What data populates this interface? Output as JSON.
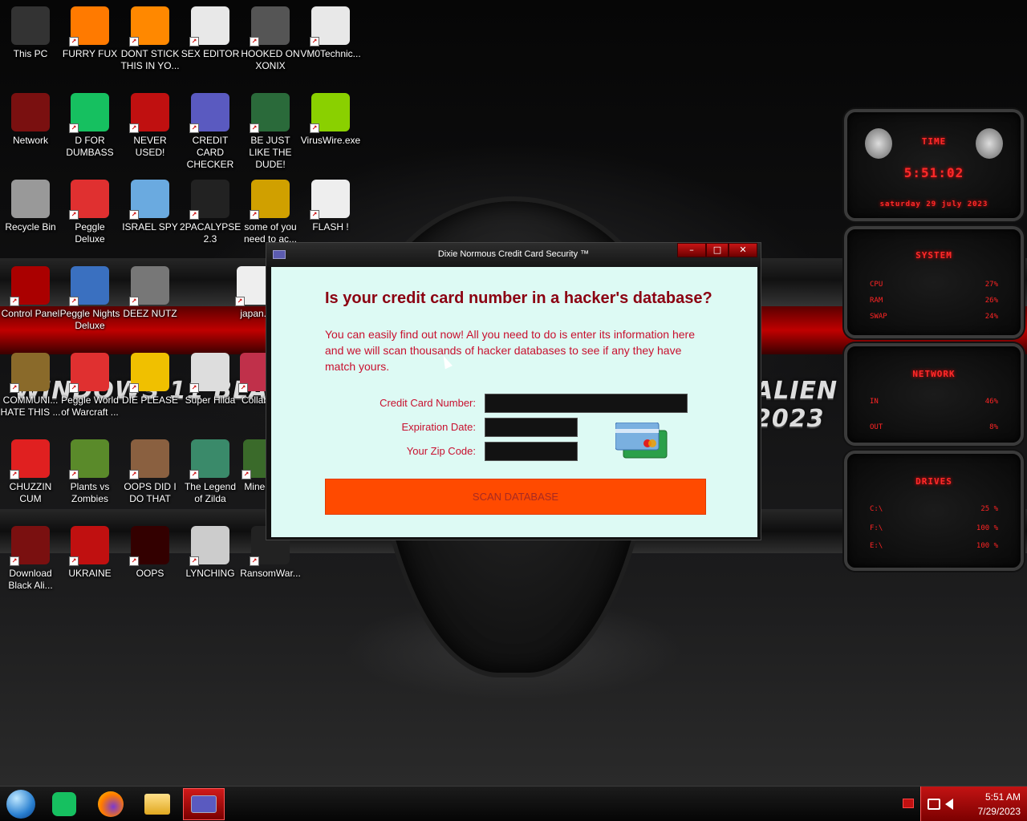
{
  "desktop": {
    "wallpaper_text_left": "WINDOWS 11 BLACK",
    "wallpaper_text_right": "ALIEN EDITION 2023",
    "icons": [
      {
        "label": "This PC",
        "icon": "computer-icon",
        "color": "#333"
      },
      {
        "label": "FURRY FUX",
        "icon": "firefox-icon",
        "color": "#ff7a00"
      },
      {
        "label": "DONT STICK THIS IN YO...",
        "icon": "vlc-cone-icon",
        "color": "#ff8800"
      },
      {
        "label": "SEX EDITOR",
        "icon": "hxd-icon",
        "color": "#e8e8e8"
      },
      {
        "label": "HOOKED ON XONIX",
        "icon": "xonix-icon",
        "color": "#555"
      },
      {
        "label": "VM0Technic...",
        "icon": "doctor-icon",
        "color": "#e8e8e8"
      },
      {
        "label": "Network",
        "icon": "alien-network-icon",
        "color": "#7a1010"
      },
      {
        "label": "D FOR DUMBASS",
        "icon": "chat-icon",
        "color": "#16c060"
      },
      {
        "label": "NEVER USED!",
        "icon": "devcpp-icon",
        "color": "#c01010"
      },
      {
        "label": "CREDIT CARD CHECKER",
        "icon": "credit-card-icon",
        "color": "#5a5ac0"
      },
      {
        "label": "BE JUST LIKE THE DUDE!",
        "icon": "santa-icon",
        "color": "#2a6a3a"
      },
      {
        "label": "VirusWire.exe",
        "icon": "lime-icon",
        "color": "#8ad000"
      },
      {
        "label": "Recycle Bin",
        "icon": "recycle-bin-icon",
        "color": "#999"
      },
      {
        "label": "Peggle Deluxe",
        "icon": "peggle-icon",
        "color": "#e03030"
      },
      {
        "label": "ISRAEL SPY",
        "icon": "network-spy-icon",
        "color": "#6aaae0"
      },
      {
        "label": "2PACALYPSE 2.3",
        "icon": "terminal-icon",
        "color": "#222"
      },
      {
        "label": "some of you need to ac...",
        "icon": "beaver-icon",
        "color": "#d0a000"
      },
      {
        "label": "FLASH !",
        "icon": "flash-icon",
        "color": "#eee"
      },
      {
        "label": "Control Panel",
        "icon": "control-panel-icon",
        "color": "#a00"
      },
      {
        "label": "Peggle Nights Deluxe",
        "icon": "peggle-nights-icon",
        "color": "#3a70c0"
      },
      {
        "label": "DEEZ NUTZ",
        "icon": "windows-stack-icon",
        "color": "#777"
      },
      {
        "label": "japan...",
        "icon": "japan-icon",
        "color": "#eee"
      },
      {
        "label": "COMMUNI... HATE THIS ...",
        "icon": "money-bag-icon",
        "color": "#8a6a2a"
      },
      {
        "label": "Peggle World of Warcraft ...",
        "icon": "peggle-wow-icon",
        "color": "#e03030"
      },
      {
        "label": "DIE PLEASE",
        "icon": "de-icon",
        "color": "#f0c000"
      },
      {
        "label": "Super Hilda",
        "icon": "pixel-dog-icon",
        "color": "#ddd"
      },
      {
        "label": "Collab...",
        "icon": "collab-icon",
        "color": "#c0304a"
      },
      {
        "label": "CHUZZIN CUM",
        "icon": "chuzzle-icon",
        "color": "#e02020"
      },
      {
        "label": "Plants vs Zombies",
        "icon": "flower-icon",
        "color": "#5a8a2a"
      },
      {
        "label": "OOPS DID I DO THAT",
        "icon": "portrait-icon",
        "color": "#8a6040"
      },
      {
        "label": "The Legend of Zilda",
        "icon": "pixel-hero-icon",
        "color": "#3a8a6a"
      },
      {
        "label": "Minecr...",
        "icon": "minecraft-icon",
        "color": "#3a6a2a"
      },
      {
        "label": "Download Black Ali...",
        "icon": "alien-download-icon",
        "color": "#7a1010"
      },
      {
        "label": "UKRAINE",
        "icon": "radiation-icon",
        "color": "#c01010"
      },
      {
        "label": "OOPS",
        "icon": "alienware-icon",
        "color": "#300"
      },
      {
        "label": "LYNCHING",
        "icon": "rope-icon",
        "color": "#ccc"
      },
      {
        "label": "RansomWar...",
        "icon": "skull-icon",
        "color": "#222"
      }
    ]
  },
  "gadgets": {
    "time": {
      "title": "TIME",
      "clock": "5:51:02",
      "date": "saturday 29 july 2023"
    },
    "system": {
      "title": "SYSTEM",
      "rows": [
        {
          "label": "CPU",
          "value": "27%"
        },
        {
          "label": "RAM",
          "value": "26%"
        },
        {
          "label": "SWAP",
          "value": "24%"
        }
      ]
    },
    "network": {
      "title": "NETWORK",
      "rows": [
        {
          "label": "IN",
          "value": "46%"
        },
        {
          "label": "OUT",
          "value": "8%"
        }
      ]
    },
    "drives": {
      "title": "DRIVES",
      "rows": [
        {
          "label": "C:\\",
          "value": "25 %"
        },
        {
          "label": "F:\\",
          "value": "100 %"
        },
        {
          "label": "E:\\",
          "value": "100 %"
        }
      ]
    }
  },
  "dialog": {
    "title": "Dixie Normous Credit Card Security ™",
    "minimize": "–",
    "maximize": "□",
    "close": "✕",
    "heading": "Is your credit card number in a hacker's database?",
    "description": "You can easily find out now! All you need to do is enter its information here and we will scan thousands of hacker databases to see if any they have match yours.",
    "fields": {
      "card_label": "Credit Card Number:",
      "card_value": "",
      "expiry_label": "Expiration Date:",
      "expiry_value": "",
      "zip_label": "Your Zip Code:",
      "zip_value": ""
    },
    "scan_button": "SCAN DATABASE"
  },
  "taskbar": {
    "items": [
      "start-orb-icon",
      "chat-app-icon",
      "firefox-icon",
      "file-explorer-icon",
      "credit-card-app-icon"
    ],
    "active_index": 4,
    "clock_time": "5:51 AM",
    "clock_date": "7/29/2023"
  }
}
